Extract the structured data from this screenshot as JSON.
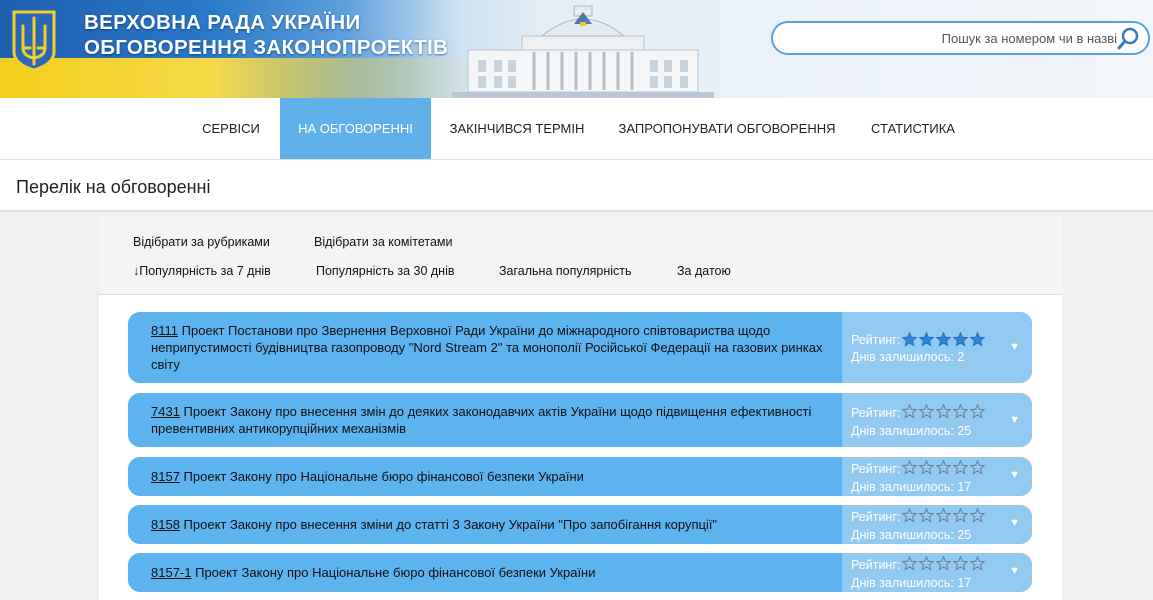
{
  "header": {
    "title_line1": "ВЕРХОВНА РАДА УКРАЇНИ",
    "title_line2": "ОБГОВОРЕННЯ ЗАКОНОПРОЕКТІВ",
    "search_placeholder": "Пошук за номером чи в назві",
    "colors": {
      "flag_blue": "#2a78c8",
      "flag_yellow": "#f2cf1c"
    }
  },
  "nav": {
    "items": [
      {
        "label": "СЕРВІСИ",
        "active": false
      },
      {
        "label": "НА ОБГОВОРЕННІ",
        "active": true
      },
      {
        "label": "ЗАКІНЧИВСЯ ТЕРМІН",
        "active": false
      },
      {
        "label": "ЗАПРОПОНУВАТИ ОБГОВОРЕННЯ",
        "active": false
      },
      {
        "label": "СТАТИСТИКА",
        "active": false
      }
    ],
    "active_color": "#5fb0e8"
  },
  "page": {
    "title": "Перелік на обговоренні"
  },
  "filters": {
    "by_rubric": "Відібрати за рубриками",
    "by_committee": "Відібрати за комітетами",
    "sort": [
      "↓Популярність за 7 днів",
      "Популярність за 30 днів",
      "Загальна популярність",
      "За датою"
    ]
  },
  "items": [
    {
      "number": "8111",
      "title": "Проект Постанови про Звернення Верховної Ради України до міжнародного співтовариства щодо неприпустимості будівництва газопроводу \"Nord Stream 2\" та монополії Російської Федерації на газових ринках світу",
      "rating_label": "Рейтинг:",
      "rating": 5,
      "days_left": "Днів залишилось: 2"
    },
    {
      "number": "7431",
      "title": "Проект Закону про внесення змін до деяких законодавчих актів України щодо підвищення ефективності превентивних антикорупційних механізмів",
      "rating_label": "Рейтинг:",
      "rating": 0,
      "days_left": "Днів залишилось: 25"
    },
    {
      "number": "8157",
      "title": "Проект Закону про Національне бюро фінансової безпеки України",
      "rating_label": "Рейтинг:",
      "rating": 0,
      "days_left": "Днів залишилось: 17"
    },
    {
      "number": "8158",
      "title": "Проект Закону про внесення зміни до статті 3 Закону України \"Про запобігання корупції\"",
      "rating_label": "Рейтинг:",
      "rating": 0,
      "days_left": "Днів залишилось: 25"
    },
    {
      "number": "8157-1",
      "title": "Проект Закону про Національне бюро фінансової безпеки України",
      "rating_label": "Рейтинг:",
      "rating": 0,
      "days_left": "Днів залишилось: 17"
    }
  ],
  "icons": {
    "expand": "chevron-down-icon",
    "star": "star-icon",
    "search": "search-icon",
    "emblem": "trident-icon"
  }
}
